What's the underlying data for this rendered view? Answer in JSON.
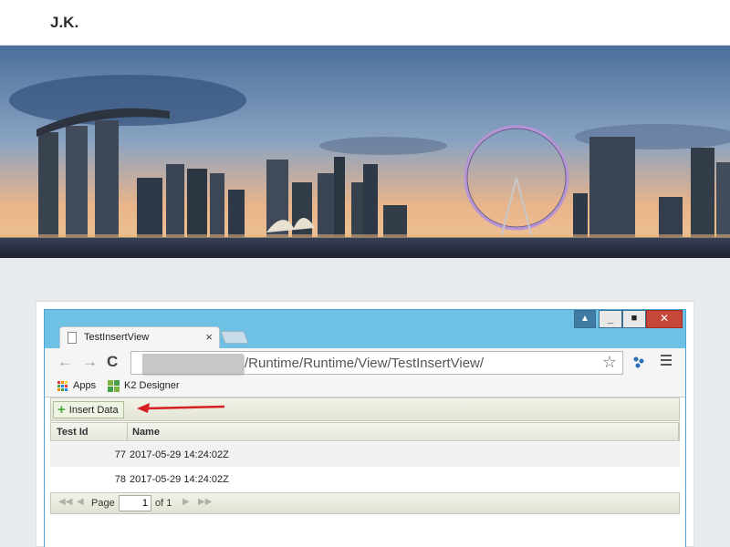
{
  "site": {
    "title": "J.K."
  },
  "browser": {
    "tab": {
      "title": "TestInsertView",
      "close": "×"
    },
    "address": {
      "path": "/Runtime/Runtime/View/TestInsertView/"
    },
    "bookmarks": [
      {
        "label": "Apps",
        "icon": "apps-grid-icon"
      },
      {
        "label": "K2 Designer",
        "icon": "k2-icon"
      }
    ]
  },
  "view": {
    "toolbar": {
      "insert_label": "Insert Data"
    },
    "columns": [
      "Test Id",
      "Name"
    ],
    "rows": [
      {
        "test_id": "77",
        "name": "2017-05-29 14:24:02Z"
      },
      {
        "test_id": "78",
        "name": "2017-05-29 14:24:02Z"
      }
    ],
    "pager": {
      "page_label": "Page",
      "current": "1",
      "of_label": "of 1"
    }
  },
  "colors": {
    "accent": "#6ec1e4",
    "close": "#c7463a",
    "insert_plus": "#4aa63a",
    "annotation_arrow": "#d42020"
  }
}
